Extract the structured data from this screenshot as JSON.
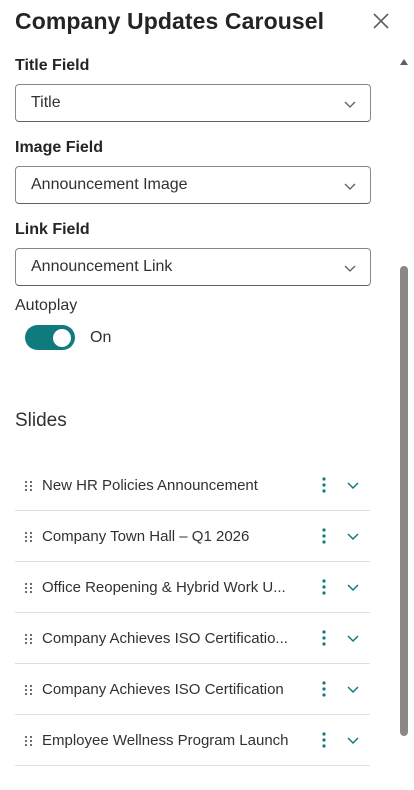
{
  "panel": {
    "title": "Company Updates Carousel"
  },
  "fields": {
    "title_field": {
      "label": "Title Field",
      "value": "Title"
    },
    "image_field": {
      "label": "Image Field",
      "value": "Announcement Image"
    },
    "link_field": {
      "label": "Link Field",
      "value": "Announcement Link"
    }
  },
  "autoplay": {
    "label": "Autoplay",
    "state_text": "On",
    "enabled": true,
    "accent_color": "#0f7b7d"
  },
  "slides": {
    "heading": "Slides",
    "items": [
      {
        "title": "New HR Policies Announcement"
      },
      {
        "title": "Company Town Hall – Q1 2026"
      },
      {
        "title": "Office Reopening & Hybrid Work U..."
      },
      {
        "title": "Company Achieves ISO Certificatio..."
      },
      {
        "title": "Company Achieves ISO Certification"
      },
      {
        "title": "Employee Wellness Program Launch"
      }
    ]
  },
  "icons": {
    "close": "close-icon",
    "dropdown": "chevron-down-icon",
    "drag": "drag-handle-icon",
    "more": "more-vertical-icon",
    "expand": "chevron-down-icon"
  }
}
